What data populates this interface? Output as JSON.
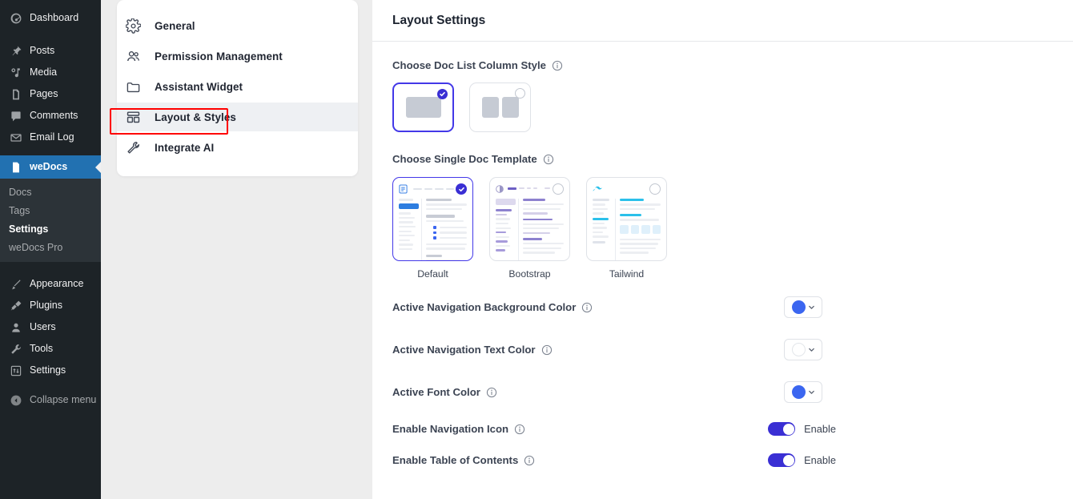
{
  "wp_sidebar": {
    "items": [
      {
        "label": "Dashboard",
        "icon": "dashboard-icon"
      },
      {
        "label": "Posts",
        "icon": "pin-icon"
      },
      {
        "label": "Media",
        "icon": "media-icon"
      },
      {
        "label": "Pages",
        "icon": "pages-icon"
      },
      {
        "label": "Comments",
        "icon": "comments-icon"
      },
      {
        "label": "Email Log",
        "icon": "envelope-icon"
      }
    ],
    "current": {
      "label": "weDocs",
      "icon": "document-icon"
    },
    "submenu": [
      {
        "label": "Docs",
        "active": false
      },
      {
        "label": "Tags",
        "active": false
      },
      {
        "label": "Settings",
        "active": true
      },
      {
        "label": "weDocs Pro",
        "active": false
      }
    ],
    "lower_items": [
      {
        "label": "Appearance",
        "icon": "appearance-icon"
      },
      {
        "label": "Plugins",
        "icon": "plugins-icon"
      },
      {
        "label": "Users",
        "icon": "users-icon"
      },
      {
        "label": "Tools",
        "icon": "tools-icon"
      },
      {
        "label": "Settings",
        "icon": "settings-icon"
      }
    ],
    "collapse": {
      "label": "Collapse menu",
      "icon": "collapse-icon"
    },
    "active_color": "#2271b1"
  },
  "settings_nav": {
    "items": [
      {
        "label": "General",
        "icon": "gear-icon",
        "active": false
      },
      {
        "label": "Permission Management",
        "icon": "users-group-icon",
        "active": false
      },
      {
        "label": "Assistant Widget",
        "icon": "folder-icon",
        "active": false
      },
      {
        "label": "Layout & Styles",
        "icon": "layout-grid-icon",
        "active": true
      },
      {
        "label": "Integrate AI",
        "icon": "wrench-icon",
        "active": false
      }
    ],
    "highlight_color": "#ff0000"
  },
  "main": {
    "title": "Layout Settings",
    "column_style": {
      "label": "Choose Doc List Column Style",
      "options": [
        {
          "name": "single-column",
          "selected": true
        },
        {
          "name": "two-column",
          "selected": false
        }
      ]
    },
    "template": {
      "label": "Choose Single Doc Template",
      "options": [
        {
          "label": "Default",
          "selected": true,
          "accent": "#2d6fe0"
        },
        {
          "label": "Bootstrap",
          "selected": false,
          "accent": "#7c6bd4"
        },
        {
          "label": "Tailwind",
          "selected": false,
          "accent": "#35bdf0"
        }
      ]
    },
    "color_rows": [
      {
        "label": "Active Navigation Background Color",
        "value": "#3b66f0",
        "empty": false
      },
      {
        "label": "Active Navigation Text Color",
        "value": "#ffffff",
        "empty": true
      },
      {
        "label": "Active Font Color",
        "value": "#3b66f0",
        "empty": false
      }
    ],
    "toggle_rows": [
      {
        "label": "Enable Navigation Icon",
        "state_label": "Enable",
        "on": true
      },
      {
        "label": "Enable Table of Contents",
        "state_label": "Enable",
        "on": true
      }
    ],
    "accent_color": "#3a2fd4"
  }
}
